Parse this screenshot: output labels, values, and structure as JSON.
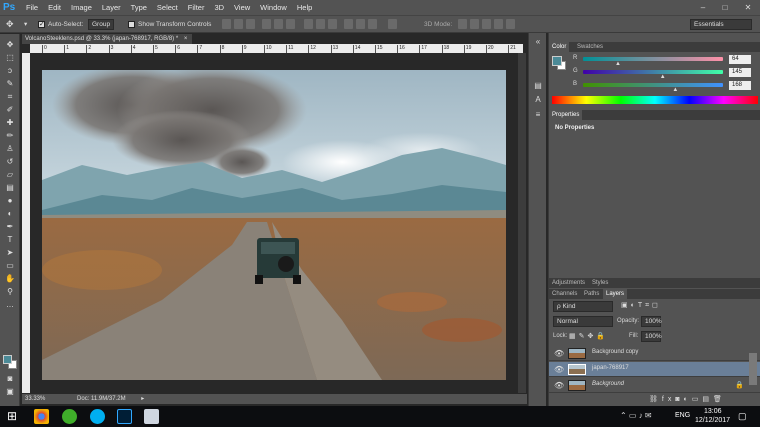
{
  "menubar": {
    "logo": "Ps",
    "items": [
      "File",
      "Edit",
      "Image",
      "Layer",
      "Type",
      "Select",
      "Filter",
      "3D",
      "View",
      "Window",
      "Help"
    ],
    "controls": [
      "–",
      "□",
      "✕"
    ]
  },
  "optionsbar": {
    "auto_select_label": "Auto-Select:",
    "auto_select_checked": true,
    "group_value": "Group",
    "show_transform_label": "Show Transform Controls",
    "mode_3d_label": "3D Mode:",
    "workspace_value": "Essentials"
  },
  "document": {
    "tab_title": "VolcanoSteeklens.psd @ 33.3% (japan-768917, RGB/8) *",
    "ruler_ticks": [
      "0",
      "1",
      "2",
      "3",
      "4",
      "5",
      "6",
      "7",
      "8",
      "9",
      "10",
      "11",
      "12",
      "13",
      "14",
      "15",
      "16",
      "17",
      "18",
      "19",
      "20",
      "21"
    ],
    "zoom": "33.33%",
    "doc_size": "Doc: 11.9M/37.2M"
  },
  "color_panel": {
    "tabs": [
      "Color",
      "Swatches"
    ],
    "active_tab": "Color",
    "fg_color": "#4b8a97",
    "channels": [
      {
        "label": "R",
        "value": "64",
        "fraction": 0.25
      },
      {
        "label": "G",
        "value": "145",
        "fraction": 0.57
      },
      {
        "label": "B",
        "value": "168",
        "fraction": 0.66
      }
    ]
  },
  "properties_panel": {
    "title": "Properties",
    "empty_text": "No Properties"
  },
  "layers_panel": {
    "top_tabs": [
      "Adjustments",
      "Styles"
    ],
    "tabs": [
      "Channels",
      "Paths",
      "Layers"
    ],
    "active_tab": "Layers",
    "filter_label": "ρ Kind",
    "blend_mode": "Normal",
    "opacity_label": "Opacity:",
    "opacity_value": "100%",
    "lock_label": "Lock:",
    "fill_label": "Fill:",
    "fill_value": "100%",
    "layers": [
      {
        "name": "Background copy",
        "selected": false
      },
      {
        "name": "japan-768917",
        "selected": true
      },
      {
        "name": "Background",
        "selected": false
      }
    ]
  },
  "taskbar": {
    "language": "ENG",
    "time": "13:06",
    "date": "12/12/2017"
  }
}
